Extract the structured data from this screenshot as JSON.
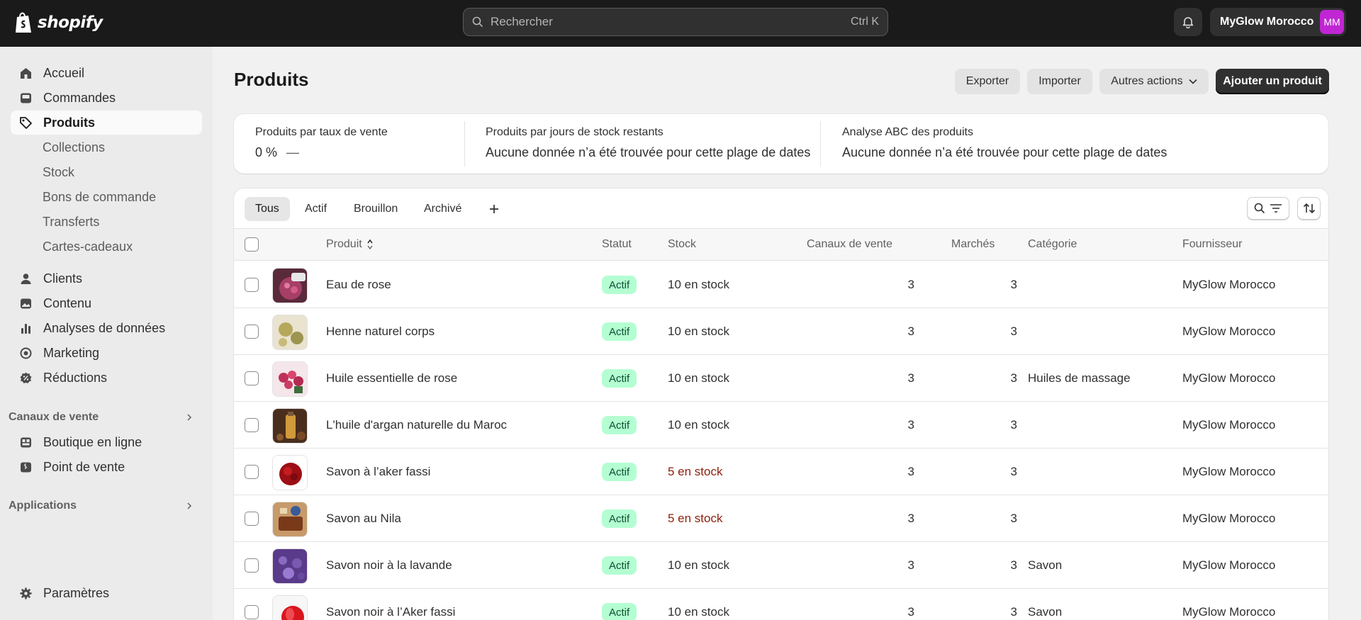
{
  "topbar": {
    "brand": "shopify",
    "search_placeholder": "Rechercher",
    "search_shortcut": "Ctrl K",
    "account_name": "MyGlow Morocco",
    "avatar_initials": "MM",
    "avatar_color": "#c026d3"
  },
  "sidebar": {
    "items": [
      {
        "label": "Accueil",
        "icon": "home-icon"
      },
      {
        "label": "Commandes",
        "icon": "inbox-icon"
      },
      {
        "label": "Produits",
        "icon": "tag-icon"
      }
    ],
    "product_subitems": [
      "Collections",
      "Stock",
      "Bons de commande",
      "Transferts",
      "Cartes-cadeaux"
    ],
    "items2": [
      {
        "label": "Clients",
        "icon": "person-icon"
      },
      {
        "label": "Contenu",
        "icon": "content-icon"
      },
      {
        "label": "Analyses de données",
        "icon": "chart-icon"
      },
      {
        "label": "Marketing",
        "icon": "target-icon"
      },
      {
        "label": "Réductions",
        "icon": "discount-icon"
      }
    ],
    "sales_channels_heading": "Canaux de vente",
    "sales_channels": [
      {
        "label": "Boutique en ligne",
        "icon": "store-icon"
      },
      {
        "label": "Point de vente",
        "icon": "pos-icon"
      }
    ],
    "apps_heading": "Applications",
    "settings_label": "Paramètres"
  },
  "header": {
    "title": "Produits",
    "export_label": "Exporter",
    "import_label": "Importer",
    "more_actions_label": "Autres actions",
    "add_product_label": "Ajouter un produit"
  },
  "stats": [
    {
      "label": "Produits par taux de vente",
      "value": "0 %",
      "trend": "—"
    },
    {
      "label": "Produits par jours de stock restants",
      "value": "Aucune donnée n’a été trouvée pour cette plage de dates"
    },
    {
      "label": "Analyse ABC des produits",
      "value": "Aucune donnée n’a été trouvée pour cette plage de dates"
    }
  ],
  "tabs": [
    "Tous",
    "Actif",
    "Brouillon",
    "Archivé"
  ],
  "table": {
    "columns": [
      "Produit",
      "Statut",
      "Stock",
      "Canaux de vente",
      "Marchés",
      "Catégorie",
      "Fournisseur"
    ],
    "rows": [
      {
        "name": "Eau de rose",
        "status": "Actif",
        "stock": "10 en stock",
        "low": false,
        "channels": "3",
        "markets": "3",
        "category": "",
        "vendor": "MyGlow Morocco",
        "thumb": "rose-water"
      },
      {
        "name": "Henne naturel corps",
        "status": "Actif",
        "stock": "10 en stock",
        "low": false,
        "channels": "3",
        "markets": "3",
        "category": "",
        "vendor": "MyGlow Morocco",
        "thumb": "henna"
      },
      {
        "name": "Huile essentielle de rose",
        "status": "Actif",
        "stock": "10 en stock",
        "low": false,
        "channels": "3",
        "markets": "3",
        "category": "Huiles de massage",
        "vendor": "MyGlow Morocco",
        "thumb": "rose-oil"
      },
      {
        "name": "L'huile d'argan naturelle du Maroc",
        "status": "Actif",
        "stock": "10 en stock",
        "low": false,
        "channels": "3",
        "markets": "3",
        "category": "",
        "vendor": "MyGlow Morocco",
        "thumb": "argan"
      },
      {
        "name": "Savon à l’aker fassi",
        "status": "Actif",
        "stock": "5 en stock",
        "low": true,
        "channels": "3",
        "markets": "3",
        "category": "",
        "vendor": "MyGlow Morocco",
        "thumb": "aker"
      },
      {
        "name": "Savon au Nila",
        "status": "Actif",
        "stock": "5 en stock",
        "low": true,
        "channels": "3",
        "markets": "3",
        "category": "",
        "vendor": "MyGlow Morocco",
        "thumb": "nila"
      },
      {
        "name": "Savon noir à la lavande",
        "status": "Actif",
        "stock": "10 en stock",
        "low": false,
        "channels": "3",
        "markets": "3",
        "category": "Savon",
        "vendor": "MyGlow Morocco",
        "thumb": "lavender"
      },
      {
        "name": "Savon noir à l’Aker fassi",
        "status": "Actif",
        "stock": "10 en stock",
        "low": false,
        "channels": "3",
        "markets": "3",
        "category": "Savon",
        "vendor": "MyGlow Morocco",
        "thumb": "aker-red"
      }
    ]
  },
  "colors": {
    "topbar": "#1a1a1a",
    "active_badge_bg": "#b4fed2",
    "active_badge_text": "#0c5132",
    "low_stock_text": "#8e1f0b"
  }
}
